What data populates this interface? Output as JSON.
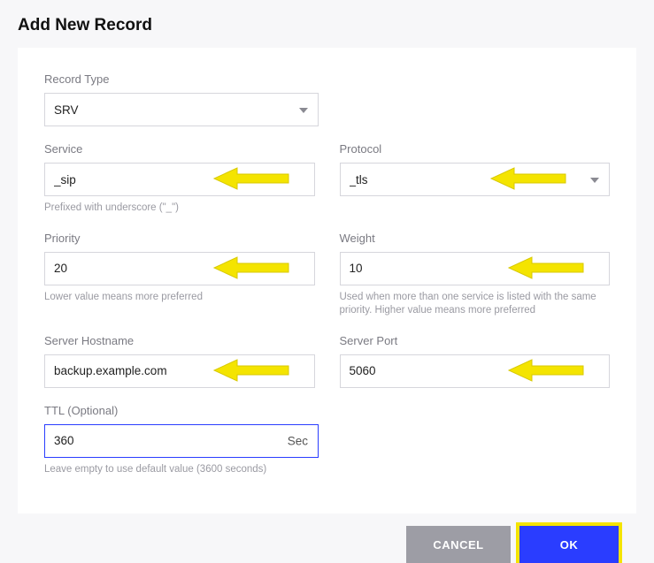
{
  "title": "Add New Record",
  "record_type": {
    "label": "Record Type",
    "value": "SRV"
  },
  "service": {
    "label": "Service",
    "value": "_sip",
    "helper": "Prefixed with underscore (\"_\")"
  },
  "protocol": {
    "label": "Protocol",
    "value": "_tls"
  },
  "priority": {
    "label": "Priority",
    "value": "20",
    "helper": "Lower value means more preferred"
  },
  "weight": {
    "label": "Weight",
    "value": "10",
    "helper": "Used when more than one service is listed with the same priority. Higher value means more preferred"
  },
  "server_hostname": {
    "label": "Server Hostname",
    "value": "backup.example.com"
  },
  "server_port": {
    "label": "Server Port",
    "value": "5060"
  },
  "ttl": {
    "label": "TTL (Optional)",
    "value": "360",
    "suffix": "Sec",
    "helper": "Leave empty to use default value (3600 seconds)"
  },
  "buttons": {
    "cancel": "CANCEL",
    "ok": "OK"
  },
  "annotation_color": "#f4e400"
}
